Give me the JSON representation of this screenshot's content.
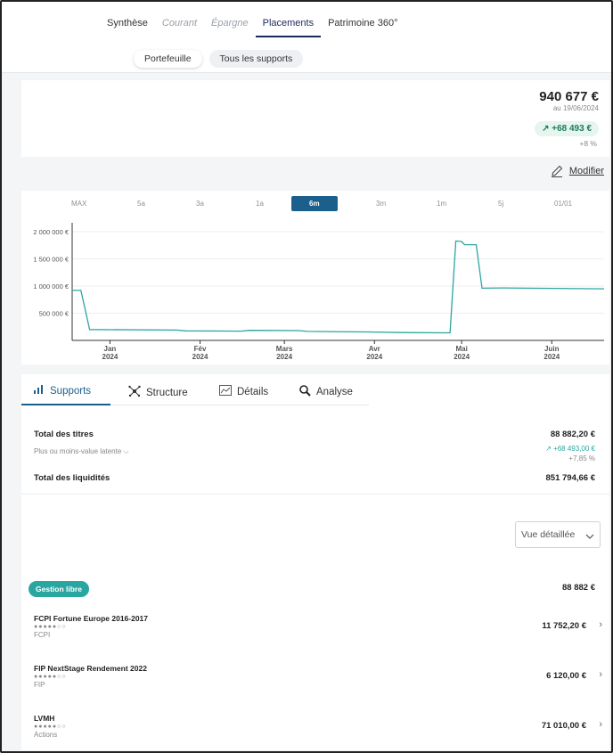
{
  "nav": {
    "tabs": [
      "Synthèse",
      "Courant",
      "Épargne",
      "Placements",
      "Patrimoine 360°"
    ],
    "subtabs": [
      "Portefeuille",
      "Tous les supports"
    ]
  },
  "summary": {
    "total": "940 677 €",
    "date": "au 19/06/2024",
    "gain": "+68 493 €",
    "gain_pct": "+8 %"
  },
  "modify_label": "Modifier",
  "ranges": [
    "MAX",
    "5a",
    "3a",
    "1a",
    "6m",
    "3m",
    "1m",
    "5j",
    "01/01"
  ],
  "chart_data": {
    "type": "line",
    "y_ticks": [
      "2 000 000 €",
      "1 500 000 €",
      "1 000 000 €",
      "500 000 €"
    ],
    "x_ticks": [
      {
        "m": "Jan",
        "y": "2024"
      },
      {
        "m": "Fév",
        "y": "2024"
      },
      {
        "m": "Mars",
        "y": "2024"
      },
      {
        "m": "Avr",
        "y": "2024"
      },
      {
        "m": "Mai",
        "y": "2024"
      },
      {
        "m": "Juin",
        "y": "2024"
      }
    ],
    "ylim": [
      0,
      2000000
    ],
    "series": [
      {
        "color": "#2aa6a0",
        "points": [
          {
            "x": "2023-12-19",
            "y": 920000
          },
          {
            "x": "2023-12-22",
            "y": 920000
          },
          {
            "x": "2023-12-25",
            "y": 200000
          },
          {
            "x": "2024-01-24",
            "y": 190000
          },
          {
            "x": "2024-01-27",
            "y": 175000
          },
          {
            "x": "2024-02-15",
            "y": 170000
          },
          {
            "x": "2024-02-18",
            "y": 185000
          },
          {
            "x": "2024-03-06",
            "y": 180000
          },
          {
            "x": "2024-03-09",
            "y": 165000
          },
          {
            "x": "2024-03-30",
            "y": 155000
          },
          {
            "x": "2024-04-10",
            "y": 145000
          },
          {
            "x": "2024-04-27",
            "y": 140000
          },
          {
            "x": "2024-04-29",
            "y": 1830000
          },
          {
            "x": "2024-05-01",
            "y": 1820000
          },
          {
            "x": "2024-05-02",
            "y": 1760000
          },
          {
            "x": "2024-05-06",
            "y": 1760000
          },
          {
            "x": "2024-05-08",
            "y": 960000
          },
          {
            "x": "2024-05-15",
            "y": 965000
          },
          {
            "x": "2024-06-19",
            "y": 950000
          }
        ]
      }
    ]
  },
  "tabs2": [
    "Supports",
    "Structure",
    "Détails",
    "Analyse"
  ],
  "totals": {
    "titres_label": "Total des titres",
    "titres_value": "88 882,20 €",
    "latent_label": "Plus ou moins-value latente",
    "latent_gain": "+68 493,00 €",
    "latent_pct": "+7,85 %",
    "liquidites_label": "Total des liquidités",
    "liquidites_value": "851 794,66 €"
  },
  "view_select": "Vue détaillée",
  "group": {
    "label": "Gestion libre",
    "value": "88 882 €"
  },
  "assets": [
    {
      "name": "FCPI Fortune Europe 2016-2017",
      "type": "FCPI",
      "value": "11 752,20 €",
      "risk": 5
    },
    {
      "name": "FIP NextStage Rendement 2022",
      "type": "FIP",
      "value": "6 120,00 €",
      "risk": 5
    },
    {
      "name": "LVMH",
      "type": "Actions",
      "value": "71 010,00 €",
      "risk": 5
    }
  ]
}
